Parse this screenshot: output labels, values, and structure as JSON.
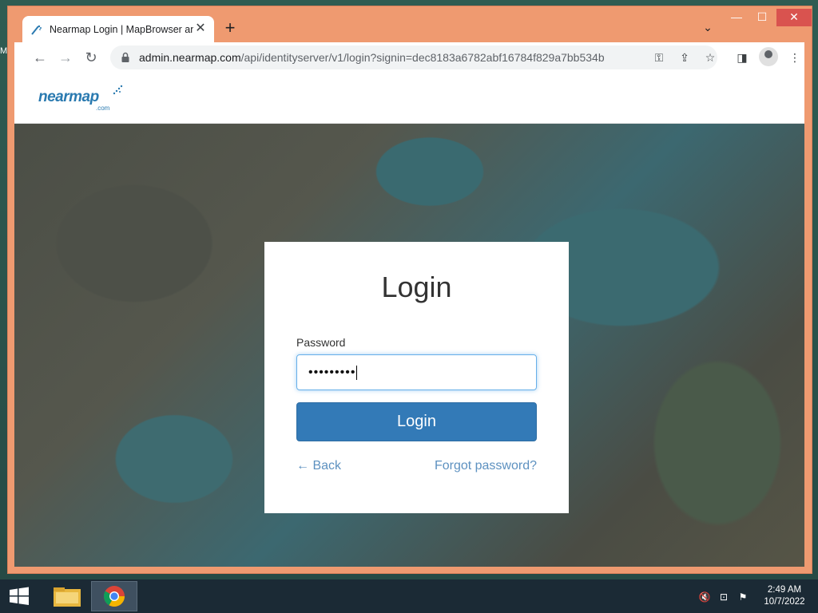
{
  "browser": {
    "tab_title": "Nearmap Login | MapBrowser an",
    "tab_close": "✕",
    "new_tab": "+",
    "url_host": "admin.nearmap.com",
    "url_path": "/api/identityserver/v1/login?signin=dec8183a6782abf16784f829a7bb534b",
    "back": "←",
    "forward": "→",
    "reload": "↻"
  },
  "window_controls": {
    "minimize": "—",
    "maximize": "☐",
    "close": "✕"
  },
  "site": {
    "logo_text": "nearmap",
    "logo_sub": ".com"
  },
  "login": {
    "title": "Login",
    "password_label": "Password",
    "password_value": "•••••••••",
    "button_label": "Login",
    "back_link": "← Back",
    "forgot_link": "Forgot password?"
  },
  "taskbar": {
    "time": "2:49 AM",
    "date": "10/7/2022"
  },
  "desktop": {
    "edge_label": "M"
  },
  "colors": {
    "window_frame": "#ef9a70",
    "login_button": "#337ab7",
    "link": "#5d91c0",
    "taskbar": "#1b2a35"
  }
}
